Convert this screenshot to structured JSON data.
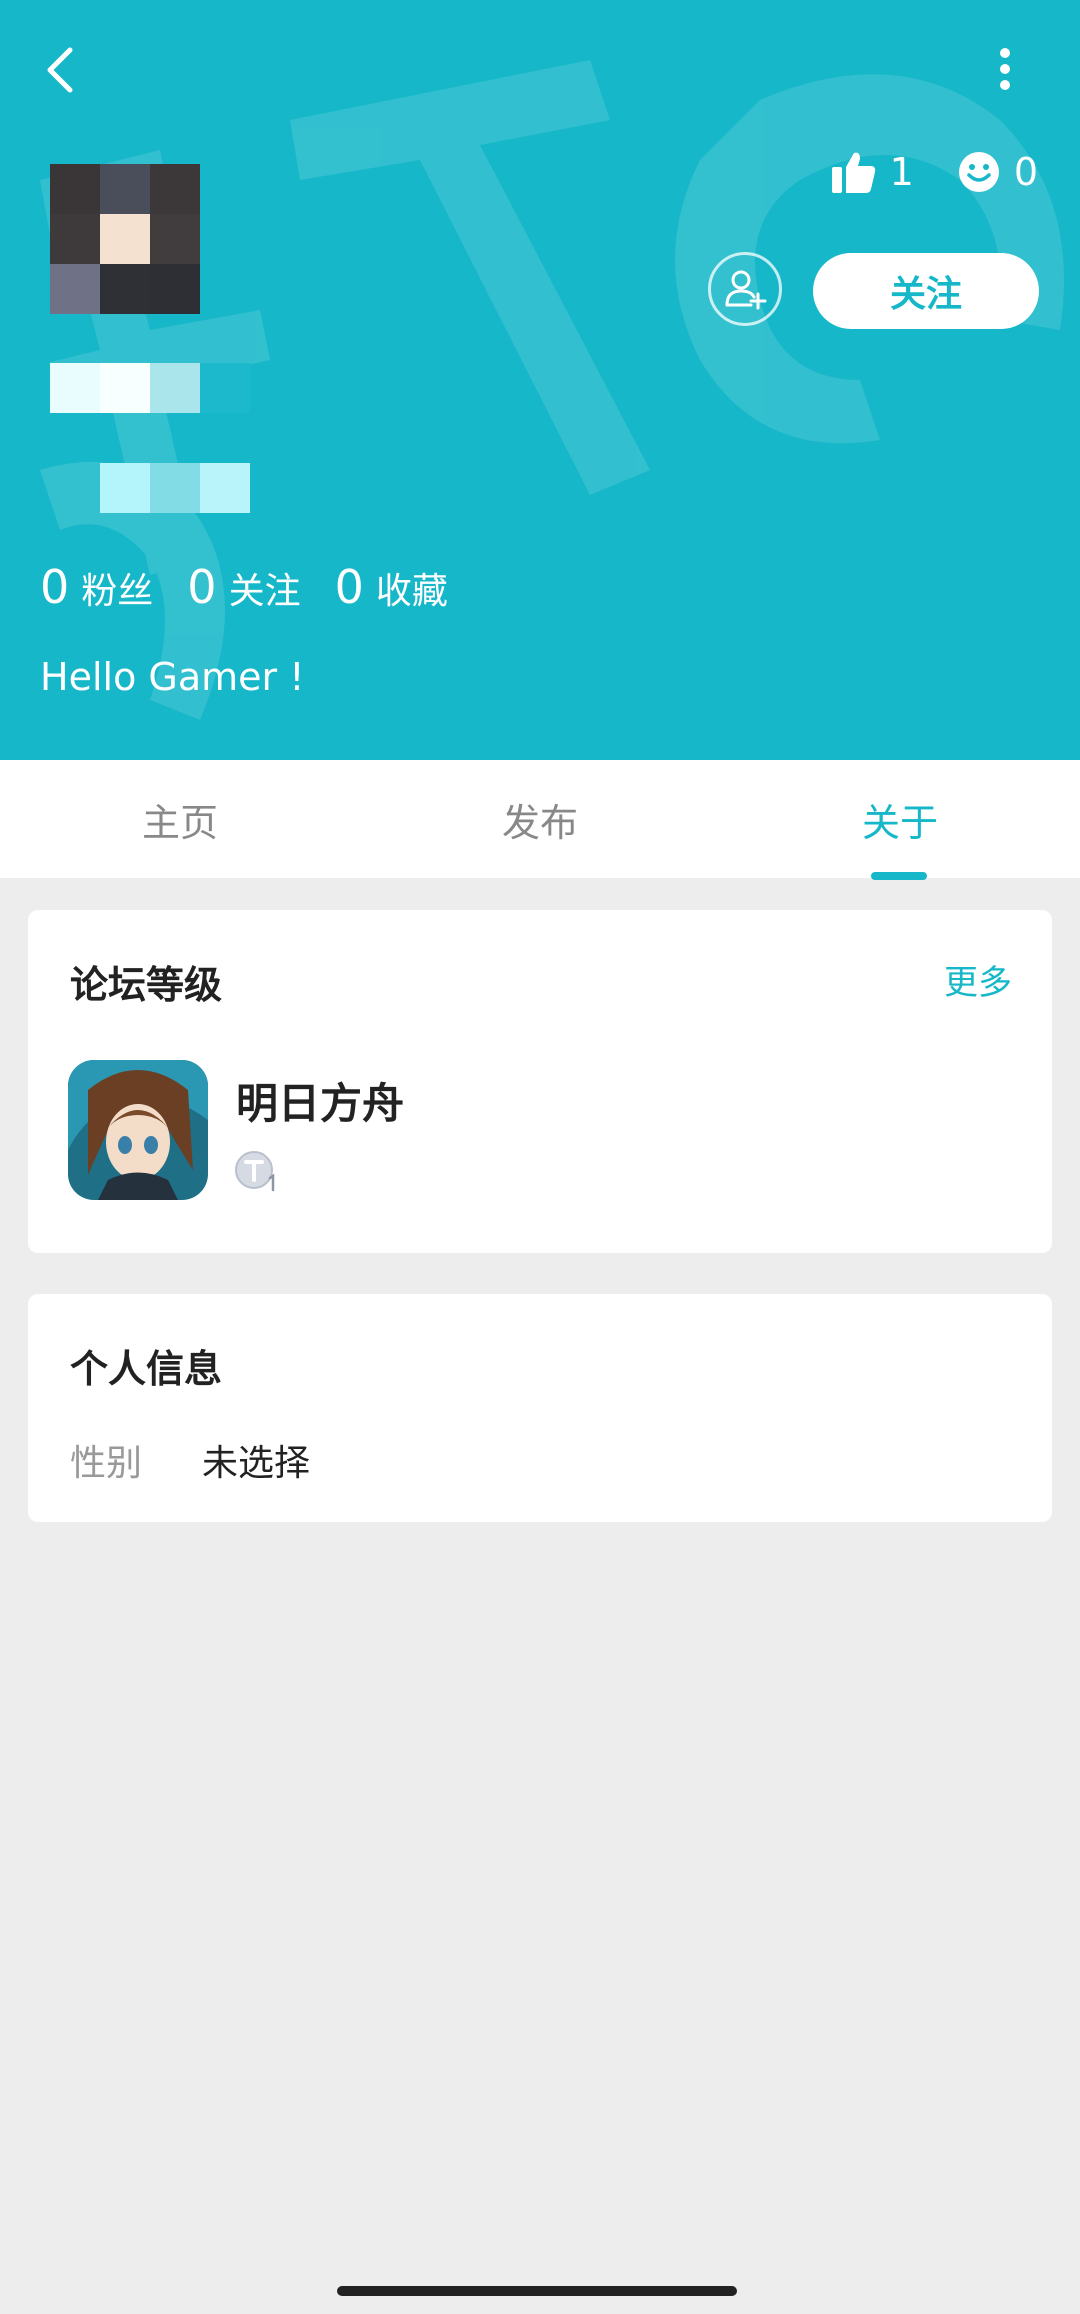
{
  "colors": {
    "accent": "#16b7c9",
    "page_bg": "#ededed",
    "card_bg": "#ffffff"
  },
  "header": {
    "back_icon": "chevron-left-icon",
    "more_icon": "vertical-dots-icon",
    "likes_icon": "thumbs-up-icon",
    "likes_count": "1",
    "smile_icon": "smile-icon",
    "smile_count": "0",
    "add_friend_icon": "add-user-icon",
    "follow_label": "关注",
    "bio": "Hello Gamer !",
    "stats": [
      {
        "value": "0",
        "label": "粉丝"
      },
      {
        "value": "0",
        "label": "关注"
      },
      {
        "value": "0",
        "label": "收藏"
      }
    ]
  },
  "tabs": [
    {
      "label": "主页",
      "active": false
    },
    {
      "label": "发布",
      "active": false
    },
    {
      "label": "关于",
      "active": true
    }
  ],
  "forum_level": {
    "title": "论坛等级",
    "more_label": "更多",
    "game_name": "明日方舟",
    "level_badge_icon": "level-badge-icon"
  },
  "personal_info": {
    "title": "个人信息",
    "gender_label": "性别",
    "gender_value": "未选择"
  }
}
